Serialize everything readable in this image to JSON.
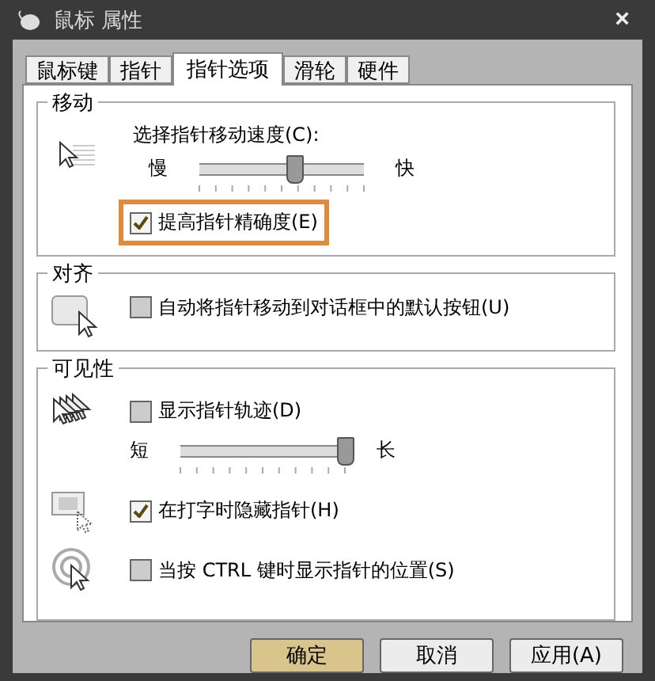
{
  "window": {
    "title": "鼠标 属性",
    "close": "×"
  },
  "tabs": [
    {
      "label": "鼠标键",
      "selected": false
    },
    {
      "label": "指针",
      "selected": false
    },
    {
      "label": "指针选项",
      "selected": true
    },
    {
      "label": "滑轮",
      "selected": false
    },
    {
      "label": "硬件",
      "selected": false
    }
  ],
  "motion": {
    "title": "移动",
    "speed_label": "选择指针移动速度(C):",
    "slow": "慢",
    "fast": "快",
    "level": 0.58,
    "precision": {
      "label": "提高指针精确度(E)",
      "checked": true,
      "highlighted": true
    }
  },
  "snap": {
    "title": "对齐",
    "option": {
      "label": "自动将指针移动到对话框中的默认按钮(U)",
      "checked": false
    }
  },
  "visibility": {
    "title": "可见性",
    "trails": {
      "label": "显示指针轨迹(D)",
      "checked": false,
      "short": "短",
      "long": "长",
      "level": 1
    },
    "options": [
      {
        "kind": "hide",
        "label": "在打字时隐藏指针(H)",
        "checked": true
      },
      {
        "kind": "locate",
        "label": "当按 CTRL 键时显示指针的位置(S)",
        "checked": false
      }
    ]
  },
  "buttons": [
    "确定",
    "取消",
    "应用(A)"
  ]
}
